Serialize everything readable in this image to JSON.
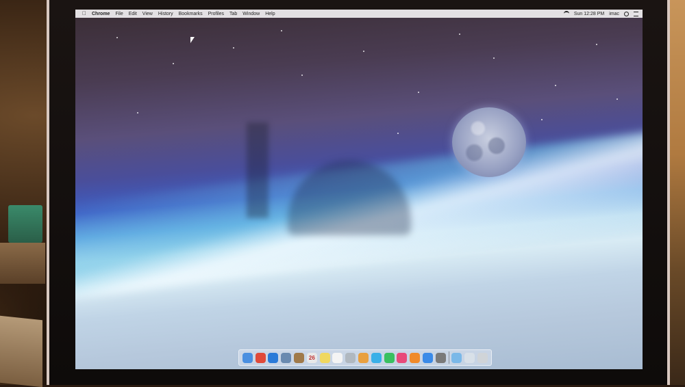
{
  "menubar": {
    "app_name": "Chrome",
    "items": [
      "File",
      "Edit",
      "View",
      "History",
      "Bookmarks",
      "Profiles",
      "Tab",
      "Window",
      "Help"
    ],
    "clock": "Sun 12:28 PM",
    "user": "imac"
  },
  "calendar_date": "26",
  "dock": {
    "apps": [
      {
        "name": "finder-icon",
        "color": "#4a8fe0"
      },
      {
        "name": "chrome-icon",
        "color": "#e04a3a"
      },
      {
        "name": "safari-icon",
        "color": "#2a7ad8"
      },
      {
        "name": "preview-icon",
        "color": "#6a8ab0"
      },
      {
        "name": "contacts-icon",
        "color": "#a07a4a"
      },
      {
        "name": "calendar-icon",
        "color": "#e8e8e8"
      },
      {
        "name": "notes-icon",
        "color": "#f0d860"
      },
      {
        "name": "reminders-icon",
        "color": "#f4f4f4"
      },
      {
        "name": "photo-booth-icon",
        "color": "#b0b8c0"
      },
      {
        "name": "photos-icon",
        "color": "#e8a040"
      },
      {
        "name": "messages-icon",
        "color": "#3ab0e8"
      },
      {
        "name": "facetime-icon",
        "color": "#3ac060"
      },
      {
        "name": "itunes-icon",
        "color": "#e84a7a"
      },
      {
        "name": "ibooks-icon",
        "color": "#f08a2a"
      },
      {
        "name": "app-store-icon",
        "color": "#3a8ae8"
      },
      {
        "name": "system-preferences-icon",
        "color": "#7a7a7a"
      }
    ],
    "trailing": [
      {
        "name": "downloads-folder-icon",
        "color": "#7ab8e8"
      },
      {
        "name": "documents-folder-icon",
        "color": "#d8e0e8"
      },
      {
        "name": "trash-icon",
        "color": "#d0d4d8"
      }
    ]
  }
}
